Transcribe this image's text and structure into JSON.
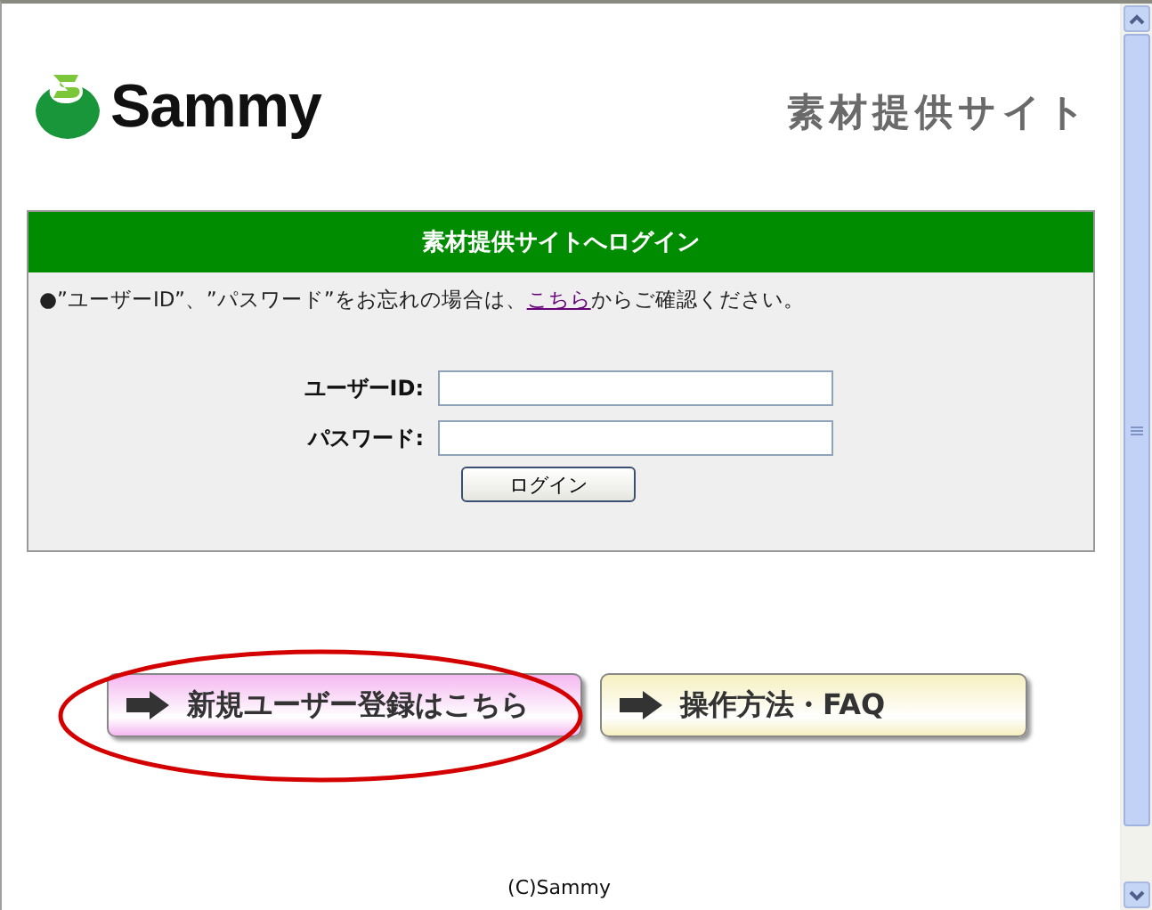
{
  "header": {
    "logo_text": "Sammy",
    "site_title": "素材提供サイト"
  },
  "login_panel": {
    "title": "素材提供サイトへログイン",
    "notice": {
      "bullet": "●",
      "before": "”ユーザーID”、”パスワード”をお忘れの場合は、",
      "link": "こちら",
      "after": "からご確認ください。"
    },
    "fields": [
      {
        "label": "ユーザーID:"
      },
      {
        "label": "パスワード:"
      }
    ],
    "submit": "ログイン"
  },
  "nav_buttons": [
    {
      "label": "新規ユーザー登録はこちら",
      "color": "#f4b8f0",
      "circled": true
    },
    {
      "label": "操作方法・FAQ",
      "color": "#f6f0c0",
      "circled": false
    }
  ],
  "footer": "(C)Sammy"
}
